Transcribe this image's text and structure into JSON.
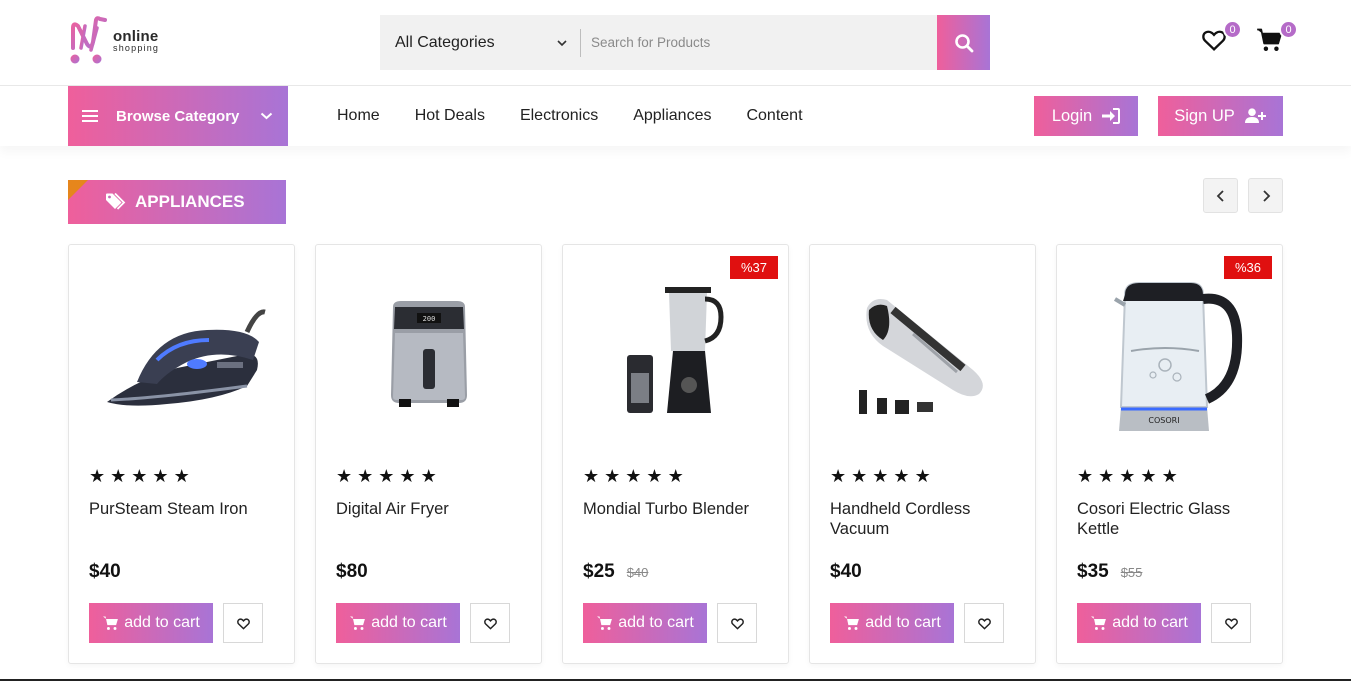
{
  "brand": {
    "line1": "online",
    "line2": "shopping"
  },
  "search": {
    "category": "All Categories",
    "placeholder": "Search for Products"
  },
  "header": {
    "wishlist_count": "0",
    "cart_count": "0"
  },
  "nav": {
    "browse_label": "Browse Category",
    "links": [
      "Home",
      "Hot Deals",
      "Electronics",
      "Appliances",
      "Content"
    ],
    "login_label": "Login",
    "signup_label": "Sign UP"
  },
  "section": {
    "title": "APPLIANCES"
  },
  "products": [
    {
      "name": "PurSteam Steam Iron",
      "price": "$40",
      "old_price": "",
      "discount": "",
      "rating": 5,
      "cart_label": "add to cart",
      "image": "steam-iron"
    },
    {
      "name": "Digital Air Fryer",
      "price": "$80",
      "old_price": "",
      "discount": "",
      "rating": 5,
      "cart_label": "add to cart",
      "image": "air-fryer"
    },
    {
      "name": "Mondial Turbo Blender",
      "price": "$25",
      "old_price": "$40",
      "discount": "%37",
      "rating": 5,
      "cart_label": "add to cart",
      "image": "blender"
    },
    {
      "name": "Handheld Cordless Vacuum",
      "price": "$40",
      "old_price": "",
      "discount": "",
      "rating": 5,
      "cart_label": "add to cart",
      "image": "handheld-vacuum"
    },
    {
      "name": "Cosori Electric Glass Kettle",
      "price": "$35",
      "old_price": "$55",
      "discount": "%36",
      "rating": 5,
      "cart_label": "add to cart",
      "image": "glass-kettle"
    }
  ],
  "theme": {
    "gradient_start": "#ef5f9b",
    "gradient_end": "#a874d6",
    "discount_red": "#e01010",
    "accent_orange": "#e6861c"
  }
}
